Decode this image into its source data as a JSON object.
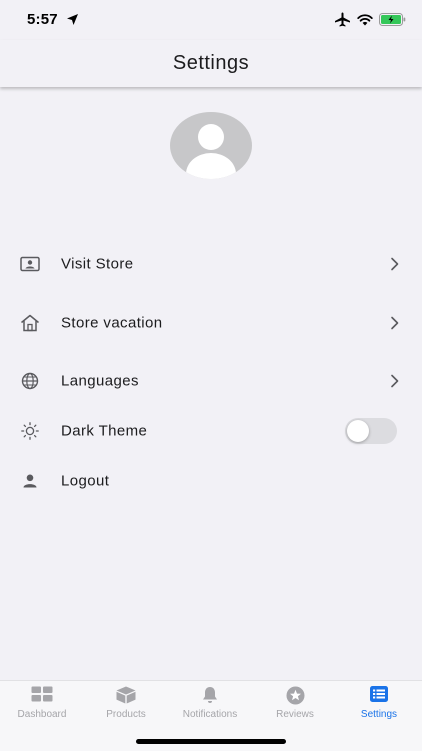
{
  "status_bar": {
    "time": "5:57"
  },
  "header": {
    "title": "Settings"
  },
  "menu": {
    "items": [
      {
        "label": "Visit Store",
        "icon": "store-window-icon"
      },
      {
        "label": "Store vacation",
        "icon": "house-icon"
      },
      {
        "label": "Languages",
        "icon": "globe-icon"
      },
      {
        "label": "Dark Theme",
        "icon": "sun-icon",
        "toggle_on": false
      },
      {
        "label": "Logout",
        "icon": "person-icon"
      }
    ]
  },
  "tabs": [
    {
      "label": "Dashboard",
      "icon": "dashboard-grid-icon"
    },
    {
      "label": "Products",
      "icon": "box-icon"
    },
    {
      "label": "Notifications",
      "icon": "bell-icon"
    },
    {
      "label": "Reviews",
      "icon": "star-circle-icon"
    },
    {
      "label": "Settings",
      "icon": "list-icon",
      "active": true
    }
  ],
  "colors": {
    "background": "#f2f1f6",
    "active_tab": "#1a73e8",
    "inactive_tab": "#a5a5a9",
    "avatar": "#c7c7c9",
    "battery": "#34c759"
  }
}
